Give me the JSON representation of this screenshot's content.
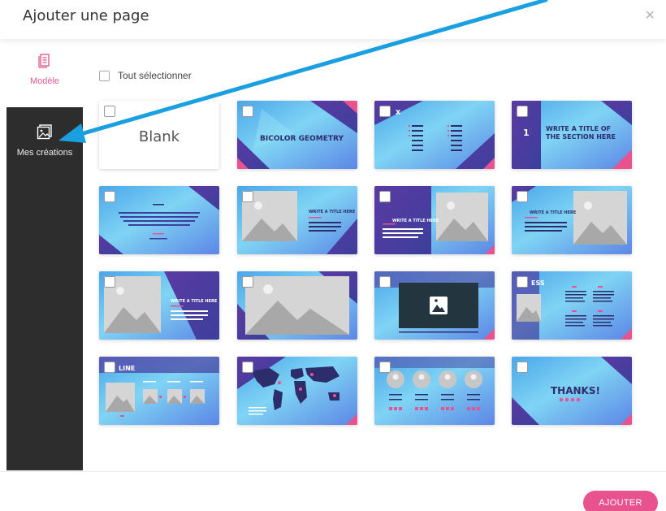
{
  "dialog": {
    "title": "Ajouter une page",
    "close_label": "×"
  },
  "sidebar": {
    "items": [
      {
        "label": "Modèle",
        "icon": "template-icon",
        "active_color": "#e05a91"
      },
      {
        "label": "Mes créations",
        "icon": "image-icon"
      }
    ]
  },
  "select_all": {
    "label": "Tout sélectionner"
  },
  "templates": [
    {
      "label": "Blank"
    },
    {
      "label": "BICOLOR GEOMETRY"
    },
    {
      "label": "X"
    },
    {
      "label": "WRITE A TITLE OF THE SECTION HERE",
      "number": "1"
    },
    {
      "label": ""
    },
    {
      "label": "WRITE A TITLE HERE"
    },
    {
      "label": "WRITE A TITLE HERE"
    },
    {
      "label": "WRITE A TITLE HERE"
    },
    {
      "label": "WRITE A TITLE HERE"
    },
    {
      "label": ""
    },
    {
      "label": ""
    },
    {
      "label": "ESS"
    },
    {
      "label": "LINE"
    },
    {
      "label": ""
    },
    {
      "label": ""
    },
    {
      "label": "THANKS!"
    }
  ],
  "footer": {
    "add_label": "AJOUTER"
  },
  "colors": {
    "accent": "#e8528f",
    "sidebar_active_bg": "#2d2d2d",
    "arrow": "#1aa0e0"
  }
}
